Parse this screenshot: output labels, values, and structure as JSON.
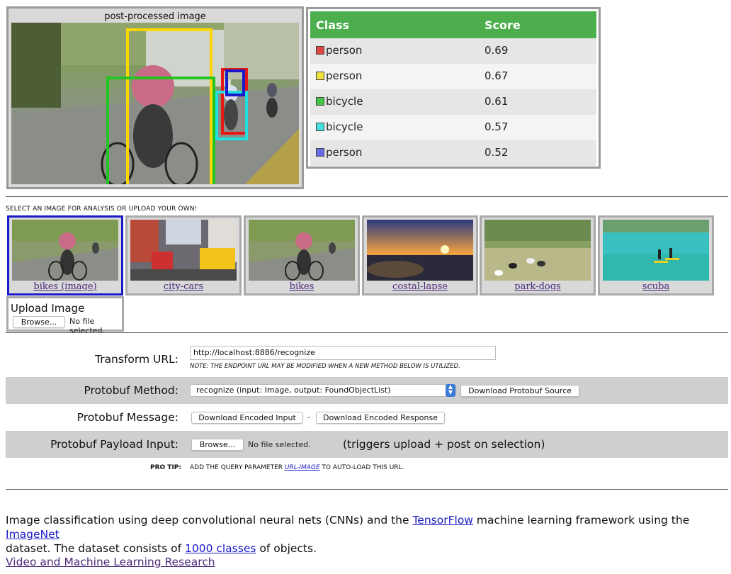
{
  "preview": {
    "caption": "post-processed image",
    "boxes": [
      {
        "color": "#ffd700",
        "label": "person"
      },
      {
        "color": "#22c522",
        "label": "bicycle"
      },
      {
        "color": "#e81515",
        "label": "person"
      },
      {
        "color": "#22e0e0",
        "label": "bicycle"
      },
      {
        "color": "#1a1ac8",
        "label": "person"
      }
    ]
  },
  "scores": {
    "header_class": "Class",
    "header_score": "Score",
    "header_color": "#4cae4c",
    "rows": [
      {
        "cls": "person",
        "score": "0.69",
        "color": "#e04545"
      },
      {
        "cls": "person",
        "score": "0.67",
        "color": "#f0e040"
      },
      {
        "cls": "bicycle",
        "score": "0.61",
        "color": "#45c545"
      },
      {
        "cls": "bicycle",
        "score": "0.57",
        "color": "#45e0e0"
      },
      {
        "cls": "person",
        "score": "0.52",
        "color": "#6a6ae8"
      }
    ]
  },
  "gallery": {
    "title": "SELECT AN IMAGE FOR ANALYSIS OR UPLOAD YOUR OWN!",
    "items": [
      {
        "label": "bikes (image)",
        "selected": true
      },
      {
        "label": "city-cars",
        "selected": false
      },
      {
        "label": "bikes",
        "selected": false
      },
      {
        "label": "costal-lapse",
        "selected": false
      },
      {
        "label": "park-dogs",
        "selected": false
      },
      {
        "label": "scuba",
        "selected": false
      }
    ]
  },
  "upload": {
    "label": "Upload Image",
    "browse": "Browse...",
    "status": "No file selected."
  },
  "form": {
    "transform_label": "Transform URL:",
    "transform_value": "http://localhost:8886/recognize",
    "transform_note": "NOTE: THE ENDPOINT URL MAY BE MODIFIED WHEN A NEW METHOD BELOW IS UTILIZED.",
    "method_label": "Protobuf Method:",
    "method_value": "recognize (input: Image, output: FoundObjectList)",
    "download_source": "Download Protobuf Source",
    "message_label": "Protobuf Message:",
    "download_input": "Download Encoded Input",
    "separator": "-",
    "download_response": "Download Encoded Response",
    "payload_label": "Protobuf Payload Input:",
    "payload_browse": "Browse...",
    "payload_status": "No file selected.",
    "payload_hint": "(triggers upload + post on selection)",
    "protip_label": "PRO TIP:",
    "protip_before": "ADD THE QUERY PARAMETER ",
    "protip_link": "URL-IMAGE",
    "protip_after": " TO AUTO-LOAD THIS URL."
  },
  "description": {
    "p1": "Image classification using deep convolutional neural nets (CNNs) and the ",
    "link1": "TensorFlow",
    "p2": " machine learning framework using the ",
    "link2": "ImageNet",
    "p3": " dataset. The dataset consists of ",
    "link3": "1000 classes",
    "p4": " of objects.",
    "research_link": "Video and Machine Learning Research"
  }
}
